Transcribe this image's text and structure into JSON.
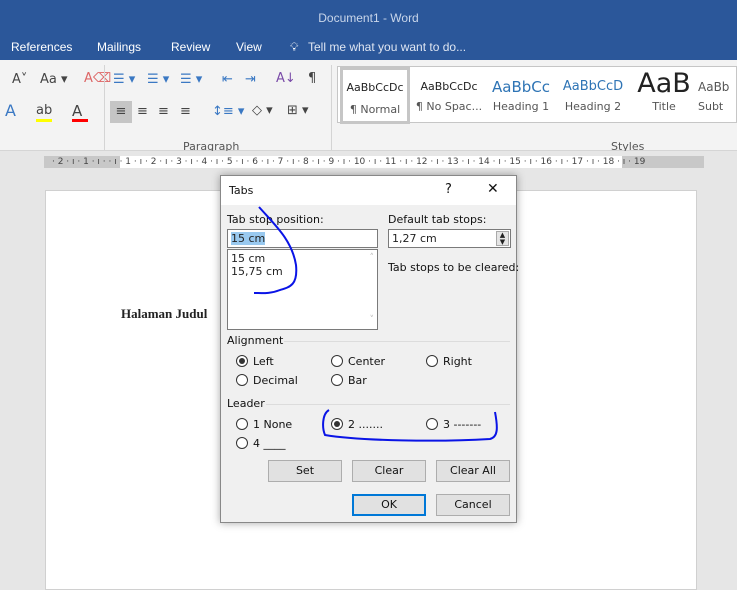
{
  "window": {
    "title": "Document1 - Word"
  },
  "tabs": [
    "References",
    "Mailings",
    "Review",
    "View"
  ],
  "tell_me": "Tell me what you want to do...",
  "ribbon": {
    "paragraph_label": "Paragraph",
    "styles_label": "Styles",
    "styles": [
      {
        "preview": "AaBbCcDc",
        "name": "¶ Normal"
      },
      {
        "preview": "AaBbCcDc",
        "name": "¶ No Spac..."
      },
      {
        "preview": "AaBbCc",
        "name": "Heading 1"
      },
      {
        "preview": "AaBbCcD",
        "name": "Heading 2"
      },
      {
        "preview": "AaB",
        "name": "Title"
      },
      {
        "preview": "AaBb",
        "name": "Subt"
      }
    ],
    "font_case": "Aa",
    "colors": {
      "highlight": "#ffff00",
      "font_color": "#ff0000"
    }
  },
  "ruler": {
    "text": "· 2 · ı · 1 · ı ·   · ı · 1 · ı · 2 · ı · 3 · ı · 4 · ı · 5 · ı · 6 · ı · 7 · ı · 8 · ı · 9 · ı · 10 · ı · 11 · ı · 12 · ı · 13 · ı · 14 · ı · 15 · ı · 16 · ı · 17 · ı · 18 · ı · 19"
  },
  "document": {
    "heading": "Halaman Judul"
  },
  "dialog": {
    "title": "Tabs",
    "help": "?",
    "close": "✕",
    "tab_stop_label": "Tab stop position:",
    "tab_stop_value": "15 cm",
    "tab_stops": [
      "15 cm",
      "15,75 cm"
    ],
    "default_label": "Default tab stops:",
    "default_value": "1,27 cm",
    "cleared_label": "Tab stops to be cleared:",
    "alignment_label": "Alignment",
    "alignment": [
      {
        "label": "Left",
        "checked": true
      },
      {
        "label": "Center",
        "checked": false
      },
      {
        "label": "Right",
        "checked": false
      },
      {
        "label": "Decimal",
        "checked": false
      },
      {
        "label": "Bar",
        "checked": false
      }
    ],
    "leader_label": "Leader",
    "leader": [
      {
        "label": "1 None",
        "checked": false
      },
      {
        "label": "2 .......",
        "checked": true
      },
      {
        "label": "3 -------",
        "checked": false
      },
      {
        "label": "4 ____",
        "checked": false
      }
    ],
    "buttons": {
      "set": "Set",
      "clear": "Clear",
      "clear_all": "Clear All",
      "ok": "OK",
      "cancel": "Cancel"
    }
  },
  "annotation_color": "#0a14e6"
}
